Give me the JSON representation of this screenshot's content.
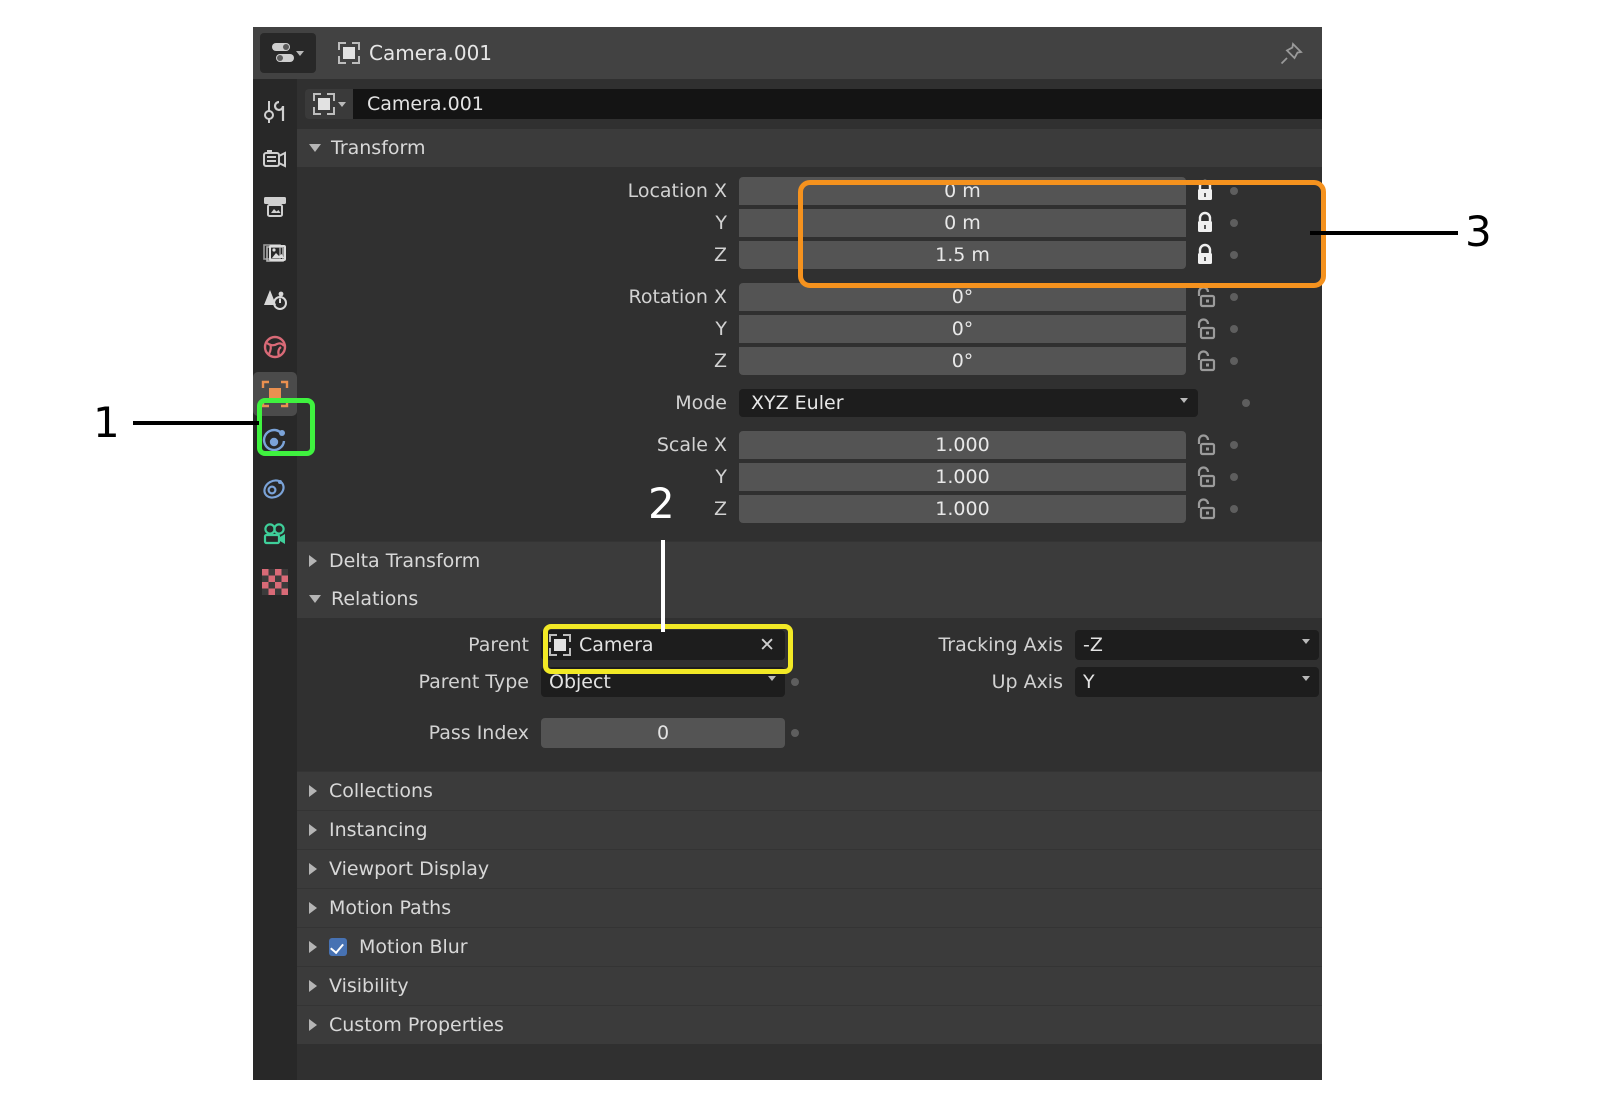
{
  "app": {
    "name": "Blender Properties Editor"
  },
  "topbar": {
    "editor_type_icon": "properties-editor-icon",
    "breadcrumb_icon": "object-icon",
    "breadcrumb_label": "Camera.001",
    "pin_icon": "pin-icon"
  },
  "tabs": [
    {
      "id": "tool",
      "icon": "tool-icon",
      "label": "Tool",
      "active": false
    },
    {
      "id": "render",
      "icon": "render-camera-icon",
      "label": "Render",
      "active": false
    },
    {
      "id": "output",
      "icon": "printer-output-icon",
      "label": "Output",
      "active": false
    },
    {
      "id": "view-layer",
      "icon": "images-stack-icon",
      "label": "View Layer",
      "active": false
    },
    {
      "id": "scene",
      "icon": "scene-cone-icon",
      "label": "Scene",
      "active": false
    },
    {
      "id": "world",
      "icon": "world-globe-icon",
      "label": "World",
      "active": false
    },
    {
      "id": "object",
      "icon": "object-square-icon",
      "label": "Object",
      "active": true
    },
    {
      "id": "modifiers",
      "icon": "physics-orbit-icon",
      "label": "Physics",
      "active": false
    },
    {
      "id": "constraints",
      "icon": "constraints-icon",
      "label": "Object Constraints",
      "active": false
    },
    {
      "id": "object-data",
      "icon": "camera-data-icon",
      "label": "Object Data",
      "active": false
    },
    {
      "id": "texture",
      "icon": "checker-texture-icon",
      "label": "Texture",
      "active": false
    }
  ],
  "name_field": {
    "icon": "object-icon",
    "value": "Camera.001"
  },
  "panels": {
    "transform": {
      "label": "Transform",
      "expanded": true,
      "rows": [
        {
          "label": "Location X",
          "value": "0 m",
          "lock": "locked",
          "decorator": true
        },
        {
          "label": "Y",
          "value": "0 m",
          "lock": "locked",
          "decorator": true
        },
        {
          "label": "Z",
          "value": "1.5 m",
          "lock": "locked",
          "decorator": true
        },
        {
          "label": "Rotation X",
          "value": "0°",
          "lock": "unlocked",
          "decorator": true
        },
        {
          "label": "Y",
          "value": "0°",
          "lock": "unlocked",
          "decorator": true
        },
        {
          "label": "Z",
          "value": "0°",
          "lock": "unlocked",
          "decorator": true
        }
      ],
      "mode": {
        "label": "Mode",
        "value": "XYZ Euler",
        "decorator": true
      },
      "scale_rows": [
        {
          "label": "Scale X",
          "value": "1.000",
          "lock": "unlocked",
          "decorator": true
        },
        {
          "label": "Y",
          "value": "1.000",
          "lock": "unlocked",
          "decorator": true
        },
        {
          "label": "Z",
          "value": "1.000",
          "lock": "unlocked",
          "decorator": true
        }
      ]
    },
    "delta_transform": {
      "label": "Delta Transform",
      "expanded": false
    },
    "relations": {
      "label": "Relations",
      "expanded": true,
      "parent": {
        "label": "Parent",
        "value": "Camera",
        "icon": "object-icon",
        "clear_icon": "x-icon"
      },
      "parent_type": {
        "label": "Parent Type",
        "value": "Object",
        "decorator": true
      },
      "pass_index": {
        "label": "Pass Index",
        "value": "0",
        "decorator": true
      },
      "tracking_axis": {
        "label": "Tracking Axis",
        "value": "-Z",
        "decorator": true
      },
      "up_axis": {
        "label": "Up Axis",
        "value": "Y",
        "decorator": true
      }
    },
    "collapsed": [
      {
        "label": "Collections",
        "checkbox": null
      },
      {
        "label": "Instancing",
        "checkbox": null
      },
      {
        "label": "Viewport Display",
        "checkbox": null
      },
      {
        "label": "Motion Paths",
        "checkbox": null
      },
      {
        "label": "Motion Blur",
        "checkbox": true
      },
      {
        "label": "Visibility",
        "checkbox": null
      },
      {
        "label": "Custom Properties",
        "checkbox": null
      }
    ]
  },
  "annotations": [
    {
      "number": "1",
      "color": "#000000",
      "target": "object-properties-tab",
      "highlight": "#3ff23f"
    },
    {
      "number": "2",
      "color": "#ffffff",
      "target": "parent-field",
      "highlight": "#f2e926"
    },
    {
      "number": "3",
      "color": "#000000",
      "target": "location-xyz-fields",
      "highlight": "#f5921e"
    }
  ],
  "colors": {
    "background": "#303030",
    "panel_header": "#3b3b3b",
    "field": "#545454",
    "field_dark": "#1d1d1d",
    "tabs_bg": "#282828",
    "accent_orange": "#f5921e",
    "accent_yellow": "#f2e926",
    "accent_green": "#3ff23f",
    "checkbox_blue": "#4772b3"
  }
}
